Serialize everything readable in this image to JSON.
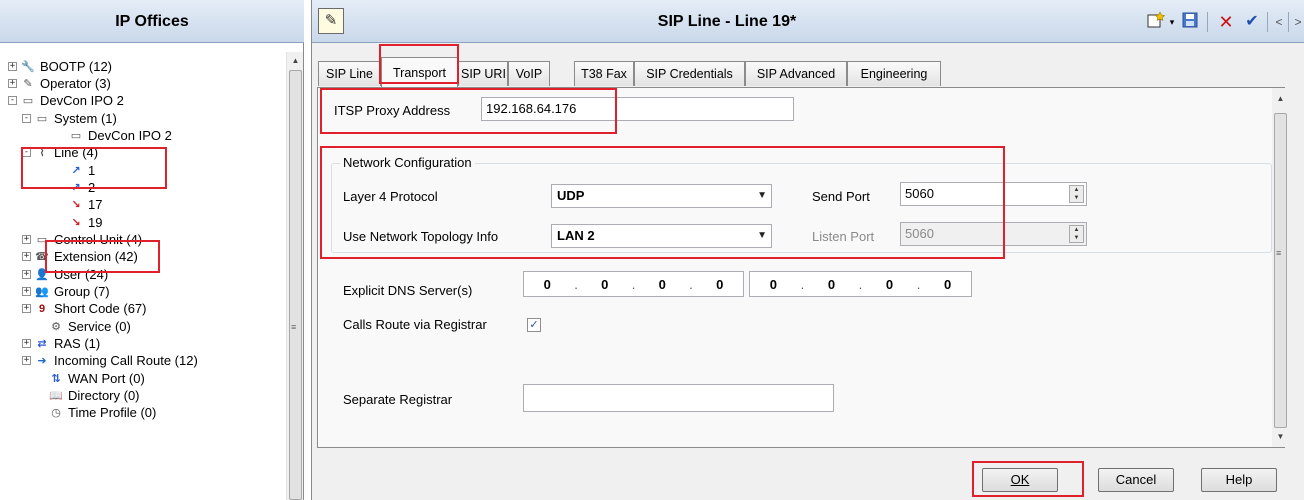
{
  "left": {
    "title": "IP Offices",
    "tree": [
      {
        "label": "BOOTP (12)",
        "icon": "bootp-icon",
        "expander": "+"
      },
      {
        "label": "Operator (3)",
        "icon": "operator-icon",
        "expander": "+"
      },
      {
        "label": "DevCon IPO 2",
        "icon": "ip-office-icon",
        "expander": "-"
      },
      {
        "label": "System (1)",
        "icon": "system-icon",
        "expander": "-"
      },
      {
        "label": "DevCon IPO 2",
        "icon": "system-unit-icon",
        "expander": ""
      },
      {
        "label": "Line (4)",
        "icon": "line-icon",
        "expander": "-"
      },
      {
        "label": "1",
        "icon": "line-item-icon",
        "expander": ""
      },
      {
        "label": "2",
        "icon": "line-item-icon",
        "expander": ""
      },
      {
        "label": "17",
        "icon": "sip-line-icon",
        "expander": ""
      },
      {
        "label": "19",
        "icon": "sip-line-icon",
        "expander": ""
      },
      {
        "label": "Control Unit (4)",
        "icon": "control-unit-icon",
        "expander": "+"
      },
      {
        "label": "Extension (42)",
        "icon": "extension-icon",
        "expander": "+"
      },
      {
        "label": "User (24)",
        "icon": "user-icon",
        "expander": "+"
      },
      {
        "label": "Group (7)",
        "icon": "group-icon",
        "expander": "+"
      },
      {
        "label": "Short Code (67)",
        "icon": "short-code-icon",
        "expander": "+"
      },
      {
        "label": "Service (0)",
        "icon": "service-icon",
        "expander": ""
      },
      {
        "label": "RAS (1)",
        "icon": "ras-icon",
        "expander": "+"
      },
      {
        "label": "Incoming Call Route (12)",
        "icon": "incoming-call-route-icon",
        "expander": "+"
      },
      {
        "label": "WAN Port (0)",
        "icon": "wan-port-icon",
        "expander": ""
      },
      {
        "label": "Directory (0)",
        "icon": "directory-icon",
        "expander": ""
      },
      {
        "label": "Time Profile (0)",
        "icon": "time-profile-icon",
        "expander": ""
      }
    ]
  },
  "right": {
    "title": "SIP Line - Line 19*",
    "toolbar": [
      "new-icon",
      "dropdown-icon",
      "save-icon",
      "delete-icon",
      "validate-icon",
      "back-icon",
      "forward-icon"
    ],
    "tabs": [
      "SIP Line",
      "Transport",
      "SIP URI",
      "VoIP",
      "T38 Fax",
      "SIP Credentials",
      "SIP Advanced",
      "Engineering"
    ],
    "active_tab": "Transport",
    "form": {
      "itsp_proxy_label": "ITSP Proxy Address",
      "itsp_proxy_value": "192.168.64.176",
      "network_group_label": "Network Configuration",
      "layer4_label": "Layer 4 Protocol",
      "layer4_value": "UDP",
      "send_port_label": "Send Port",
      "send_port_value": "5060",
      "topology_label": "Use Network Topology Info",
      "topology_value": "LAN 2",
      "listen_port_label": "Listen Port",
      "listen_port_value": "5060",
      "dns_label": "Explicit DNS Server(s)",
      "dns1": [
        "0",
        "0",
        "0",
        "0"
      ],
      "dns2": [
        "0",
        "0",
        "0",
        "0"
      ],
      "calls_route_label": "Calls Route via Registrar",
      "calls_route_checked": true,
      "separate_registrar_label": "Separate Registrar",
      "separate_registrar_value": ""
    },
    "buttons": {
      "ok": "OK",
      "cancel": "Cancel",
      "help": "Help"
    }
  },
  "colors": {
    "highlight": "#e0202a",
    "header_gradient_top": "#e5edf7",
    "header_gradient_bottom": "#c9d8ea"
  }
}
